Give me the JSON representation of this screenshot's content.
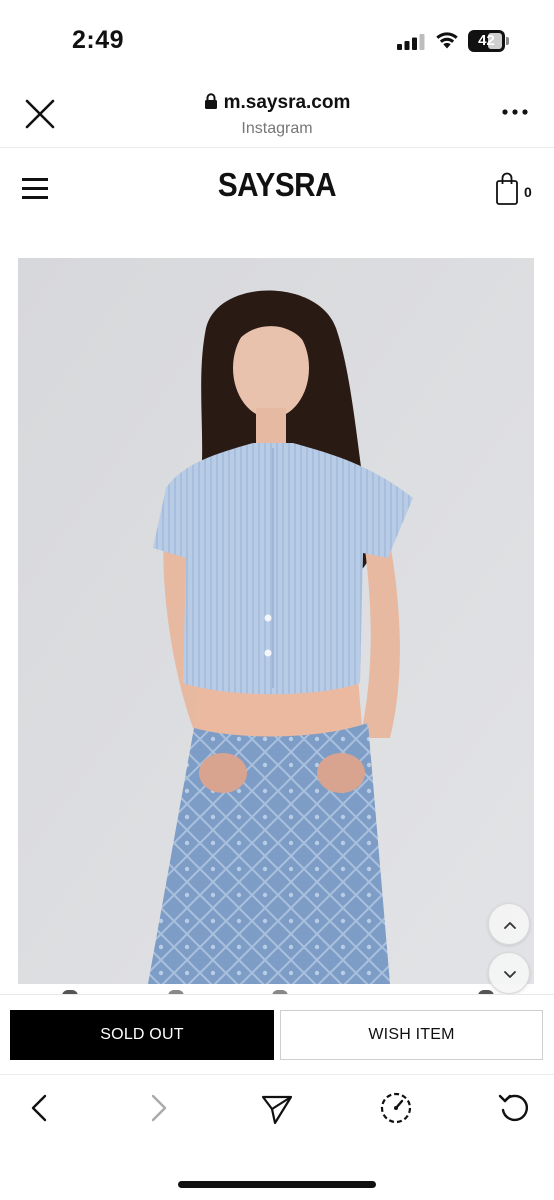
{
  "status_bar": {
    "time": "2:49",
    "battery": "42",
    "signal_icon": "cellular-signal-icon",
    "wifi_icon": "wifi-icon"
  },
  "browser": {
    "url": "m.saysra.com",
    "source": "Instagram",
    "close_icon": "close-icon",
    "more_icon": "more-icon",
    "lock_icon": "lock-icon"
  },
  "site": {
    "logo": "SAYSRA",
    "cart_count": "0",
    "menu_icon": "hamburger-menu-icon",
    "cart_icon": "shopping-bag-icon"
  },
  "product": {
    "image_alt": "product-photo",
    "scroll_up_icon": "chevron-up-icon",
    "scroll_down_icon": "chevron-down-icon"
  },
  "actions": {
    "sold_out_label": "SOLD OUT",
    "wish_item_label": "WISH ITEM"
  },
  "toolbar": {
    "icons": [
      "back-icon",
      "forward-icon",
      "send-icon",
      "speed-icon",
      "reload-icon"
    ]
  },
  "colors": {
    "primary_button": "#000000",
    "background": "#ffffff",
    "muted_text": "#777777"
  }
}
